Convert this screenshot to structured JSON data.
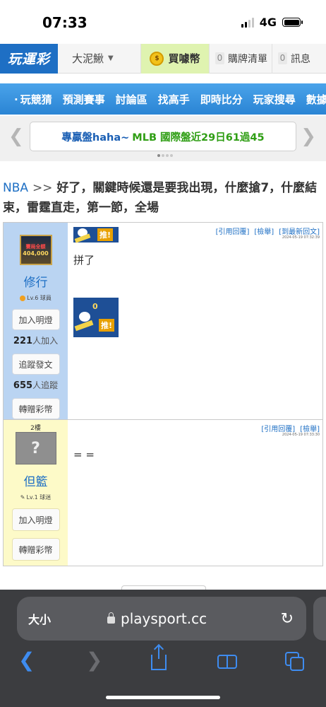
{
  "status_bar": {
    "time": "07:33",
    "network": "4G"
  },
  "nav": {
    "logo": "玩運彩",
    "user": "大泥鰍",
    "buy": "買噱幣",
    "lottery": {
      "count": "0",
      "label": "購牌清單"
    },
    "messages": {
      "count": "0",
      "label": "訊息"
    }
  },
  "menu": [
    "玩競猜",
    "預測賽事",
    "討論區",
    "找高手",
    "即時比分",
    "玩家搜尋",
    "數據"
  ],
  "carousel": {
    "text_blue": "專贏盤haha~",
    "text_green": "MLB 國際盤近29日61過45"
  },
  "thread": {
    "category": "NBA",
    "separator": ">>",
    "title": "好了，關鍵時候還是要我出現，什麼搶7，什麼結束，雷霆直走，第一節，全場"
  },
  "posts": [
    {
      "floor": "",
      "avatar_badge_top": "賽局全額",
      "avatar_badge_num": "404,000",
      "username": "修行",
      "level": "Lv.6 球員",
      "add_light": "加入明燈",
      "light_count": "221",
      "light_suffix": "人加入",
      "follow": "追蹤發文",
      "follow_count": "655",
      "follow_suffix": "人追蹤",
      "gift": "轉贈彩幣",
      "links": [
        "[引用回覆]",
        "[檢舉]",
        "[到最新回文]"
      ],
      "timestamp": "2024-05-19 07:32:39",
      "push_label": "推!",
      "content": "拼了",
      "push_count": "0"
    },
    {
      "floor": "2樓",
      "username": "但籃",
      "level": "Lv.1 球迷",
      "add_light": "加入明燈",
      "gift": "轉贈彩幣",
      "links": [
        "[引用回覆]",
        "[檢舉]"
      ],
      "timestamp": "2024-05-19 07:33:30",
      "content": "= ="
    }
  ],
  "browser": {
    "text_size": "大小",
    "url": "playsport.cc"
  }
}
